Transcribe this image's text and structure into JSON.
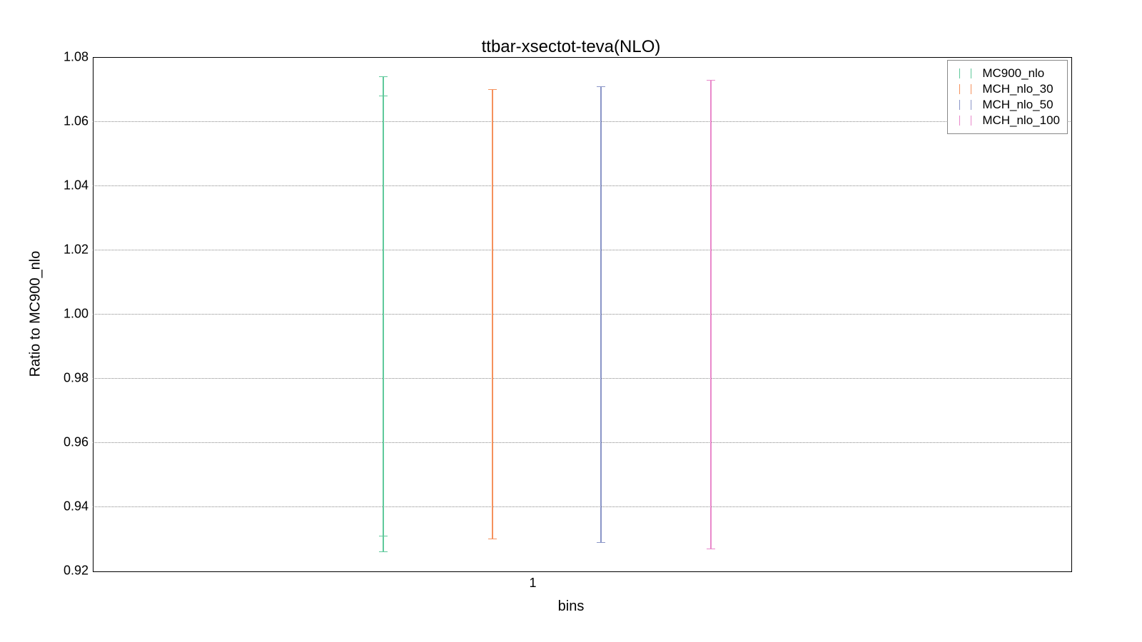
{
  "chart_data": {
    "type": "errorbar",
    "title": "ttbar-xsectot-teva(NLO)",
    "xlabel": "bins",
    "ylabel": "Ratio to MC900_nlo",
    "ylim": [
      0.92,
      1.08
    ],
    "yticks": [
      0.92,
      0.94,
      0.96,
      0.98,
      1.0,
      1.02,
      1.04,
      1.06,
      1.08
    ],
    "ytick_labels": [
      "0.92",
      "0.94",
      "0.96",
      "0.98",
      "1.00",
      "1.02",
      "1.04",
      "1.06",
      "1.08"
    ],
    "xticks": [
      1
    ],
    "xtick_labels": [
      "1"
    ],
    "series": [
      {
        "name": "MC900_nlo",
        "color": "#5fc99b",
        "x": 1,
        "center": 1.0,
        "low": 0.926,
        "high": 1.074,
        "inner_low": 0.931,
        "inner_high": 1.068
      },
      {
        "name": "MCH_nlo_30",
        "color": "#f5915c",
        "x": 1,
        "center": 1.0,
        "low": 0.93,
        "high": 1.07
      },
      {
        "name": "MCH_nlo_50",
        "color": "#8a95c7",
        "x": 1,
        "center": 1.0,
        "low": 0.929,
        "high": 1.071
      },
      {
        "name": "MCH_nlo_100",
        "color": "#e989cb",
        "x": 1,
        "center": 1.0,
        "low": 0.927,
        "high": 1.073
      }
    ]
  }
}
